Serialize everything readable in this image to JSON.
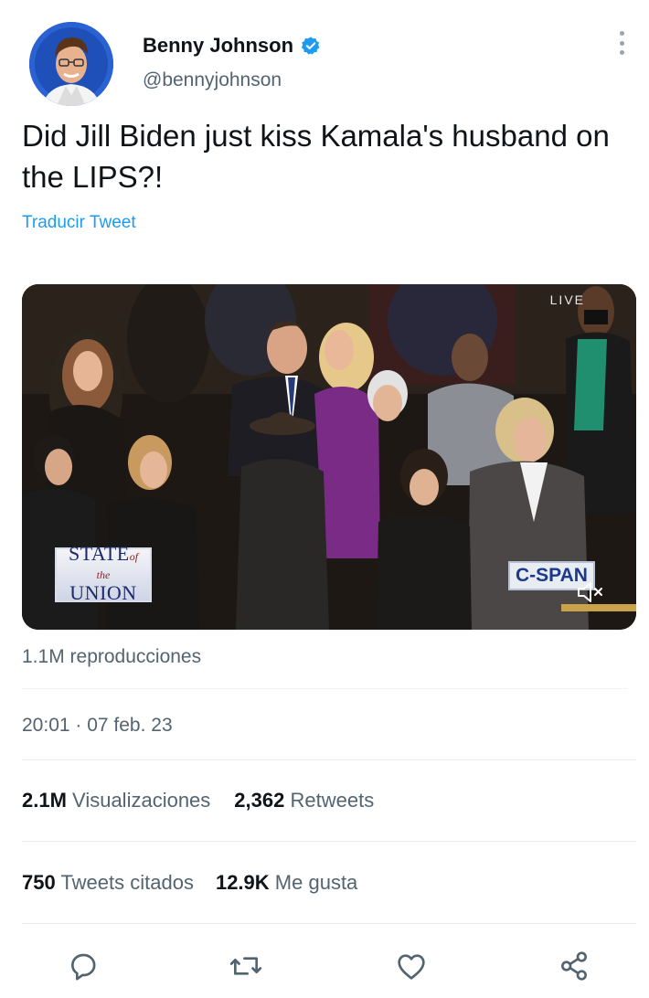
{
  "author": {
    "display_name": "Benny Johnson",
    "handle": "@bennyjohnson",
    "verified": true
  },
  "tweet": {
    "text": "Did Jill Biden just kiss Kamala's husband on the LIPS?!",
    "translate_label": "Traducir Tweet"
  },
  "media": {
    "live_label": "LIVE",
    "sotu_line1": "STATE",
    "sotu_of": "of",
    "sotu_the": "the",
    "sotu_line2": "UNION",
    "network_label": "C-SPAN"
  },
  "views_text": "1.1M reproducciones",
  "timestamp": "20:01 · 07 feb. 23",
  "stats": {
    "visualizaciones": {
      "value": "2.1M",
      "label": "Visualizaciones"
    },
    "retweets": {
      "value": "2,362",
      "label": "Retweets"
    },
    "quotes": {
      "value": "750",
      "label": "Tweets citados"
    },
    "likes": {
      "value": "12.9K",
      "label": "Me gusta"
    }
  },
  "actions": [
    "reply-icon",
    "retweet-icon",
    "like-icon",
    "share-icon"
  ],
  "colors": {
    "link": "#1d9bf0",
    "verified": "#1d9bf0",
    "secondary_text": "#536471",
    "primary_text": "#0f1419"
  }
}
